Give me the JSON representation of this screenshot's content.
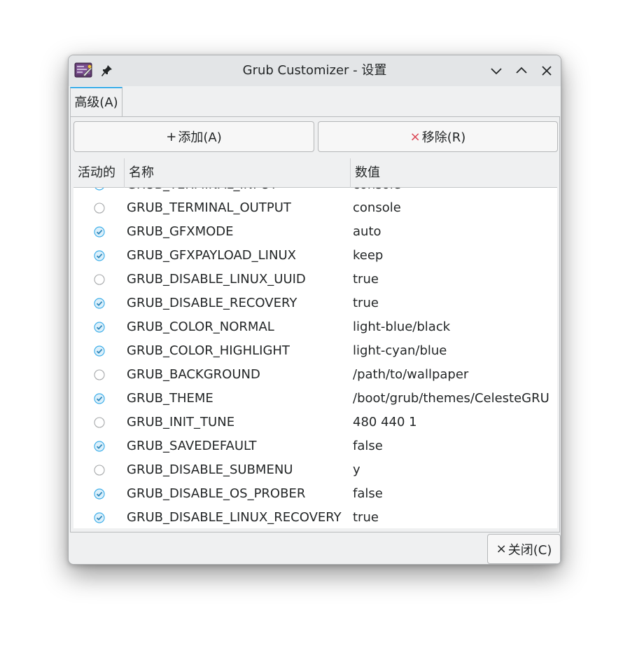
{
  "window": {
    "title": "Grub Customizer - 设置",
    "icons": {
      "app": "grub-customizer-app-icon",
      "pin": "pin-icon",
      "minimize": "chevron-down-icon",
      "maximize": "chevron-up-icon",
      "close": "close-icon"
    }
  },
  "tabs": [
    {
      "label": "高级(A)",
      "active": true
    }
  ],
  "toolbar": {
    "add_icon": "+",
    "add_label": "添加(A)",
    "remove_icon": "×",
    "remove_label": "移除(R)"
  },
  "table": {
    "headers": {
      "active": "活动的",
      "name": "名称",
      "value": "数值"
    },
    "partial_row": {
      "name": "GRUB_TERMINAL_INPUT",
      "value": "console",
      "checked": true
    },
    "rows": [
      {
        "checked": false,
        "name": "GRUB_TERMINAL_OUTPUT",
        "value": "console"
      },
      {
        "checked": true,
        "name": "GRUB_GFXMODE",
        "value": "auto"
      },
      {
        "checked": true,
        "name": "GRUB_GFXPAYLOAD_LINUX",
        "value": "keep"
      },
      {
        "checked": false,
        "name": "GRUB_DISABLE_LINUX_UUID",
        "value": "true"
      },
      {
        "checked": true,
        "name": "GRUB_DISABLE_RECOVERY",
        "value": "true"
      },
      {
        "checked": true,
        "name": "GRUB_COLOR_NORMAL",
        "value": "light-blue/black"
      },
      {
        "checked": true,
        "name": "GRUB_COLOR_HIGHLIGHT",
        "value": "light-cyan/blue"
      },
      {
        "checked": false,
        "name": "GRUB_BACKGROUND",
        "value": "/path/to/wallpaper"
      },
      {
        "checked": true,
        "name": "GRUB_THEME",
        "value": "/boot/grub/themes/CelesteGRU"
      },
      {
        "checked": false,
        "name": "GRUB_INIT_TUNE",
        "value": "480 440 1"
      },
      {
        "checked": true,
        "name": "GRUB_SAVEDEFAULT",
        "value": "false"
      },
      {
        "checked": false,
        "name": "GRUB_DISABLE_SUBMENU",
        "value": "y"
      },
      {
        "checked": true,
        "name": "GRUB_DISABLE_OS_PROBER",
        "value": "false"
      },
      {
        "checked": true,
        "name": "GRUB_DISABLE_LINUX_RECOVERY",
        "value": "true"
      }
    ]
  },
  "footer": {
    "close_icon": "×",
    "close_label": "关闭(C)"
  },
  "colors": {
    "accent": "#3daee9",
    "text": "#232627",
    "window_bg": "#eff0f1",
    "titlebar_bg": "#e3e5e7",
    "remove_icon": "#da4453"
  }
}
